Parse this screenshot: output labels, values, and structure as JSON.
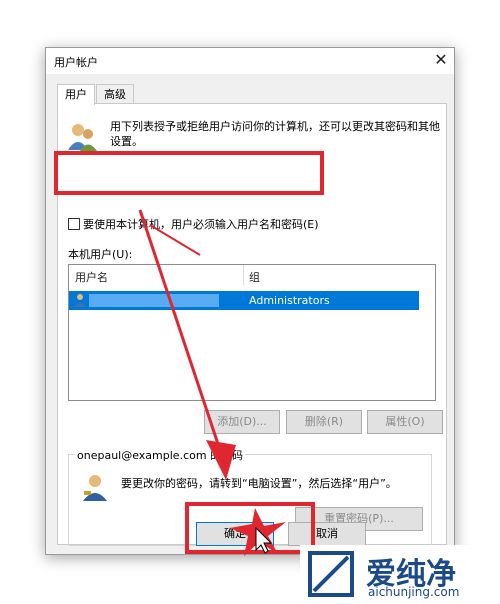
{
  "window": {
    "title": "用户帐户",
    "close_glyph": "✕"
  },
  "tabs": [
    {
      "label": "用户",
      "active": true
    },
    {
      "label": "高级",
      "active": false
    }
  ],
  "description": "用下列表授予或拒绝用户访问你的计算机，还可以更改其密码和其他设置。",
  "require_password_checkbox": {
    "label": "要使用本计算机，用户必须输入用户名和密码(E)",
    "checked": false
  },
  "local_users": {
    "label": "本机用户(U):",
    "columns": [
      "用户名",
      "组"
    ],
    "rows": [
      {
        "name": "",
        "group": "Administrators",
        "selected": true
      }
    ]
  },
  "list_buttons": {
    "add": "添加(D)...",
    "remove": "删除(R)",
    "properties": "属性(O)"
  },
  "password_group": {
    "title_user": "onepaul@example.com",
    "title_suffix": "的密码",
    "text": "要更改你的密码，请转到“电脑设置”，然后选择“用户”。",
    "reset_button": "重置密码(P)..."
  },
  "footer_buttons": {
    "ok": "确定",
    "cancel": "取消"
  },
  "watermark": {
    "brand": "爱纯净",
    "url": "aichunjing.com"
  },
  "colors": {
    "accent": "#0078d7",
    "highlight": "#e0262e"
  }
}
